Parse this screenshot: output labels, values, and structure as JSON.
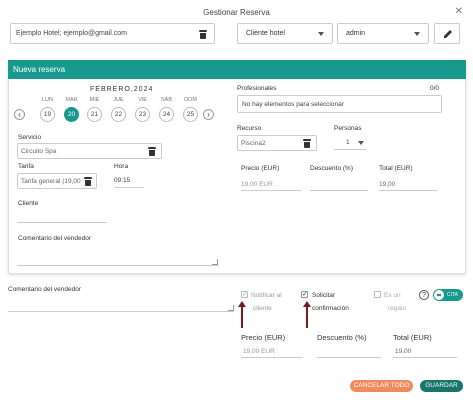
{
  "dialog": {
    "title": "Gestionar Reserva"
  },
  "customer_field": {
    "value": "Ejemplo Hotel; ejemplo@gmail.com"
  },
  "client_type_select": {
    "value": "Cliente hotel"
  },
  "user_select": {
    "value": "admin"
  },
  "panel": {
    "title": "Nueva reserva"
  },
  "calendar": {
    "month": "FEBRERO,2024",
    "dows": [
      "LUN",
      "MAR",
      "MIÉ",
      "JUE",
      "VIE",
      "SÁB",
      "DOM"
    ],
    "days": [
      "19",
      "20",
      "21",
      "22",
      "23",
      "24",
      "25"
    ],
    "selected_day": "20"
  },
  "form": {
    "servicio_label": "Servicio",
    "servicio_value": "Circuito Spa",
    "tarifa_label": "Tarifa",
    "tarifa_value": "Tarifa general (19,00",
    "hora_label": "Hora",
    "hora_value": "09:15",
    "cliente_label": "Cliente",
    "comentario_label": "Comentario del vendedor",
    "profesionales_label": "Profesionales",
    "profesionales_count": "0/0",
    "profesionales_placeholder": "No hay elementos para seleccionar",
    "recurso_label": "Recurso",
    "recurso_value": "Piscina2",
    "personas_label": "Personas",
    "personas_value": "1",
    "precio_label": "Precio (EUR)",
    "precio_value": "19,00 EUR",
    "descuento_label": "Descuento (%)",
    "total_label": "Total (EUR)",
    "total_value": "19,00"
  },
  "bottom": {
    "comentario_label": "Comentario del vendedor",
    "notificar_line1": "Notificar al",
    "notificar_line2": "cliente",
    "solicitar_line1": "Solicitar",
    "solicitar_line2": "confirmación",
    "regalo_line1": "Es un",
    "regalo_line2": "regalo",
    "toggle_text": "CITA",
    "precio_label": "Precio (EUR)",
    "precio_value": "19,00 EUR",
    "descuento_label": "Descuento (%)",
    "total_label": "Total (EUR)",
    "total_value": "19,00"
  },
  "actions": {
    "cancel_label": "CANCELAR TODO",
    "save_label": "GUARDAR"
  },
  "colors": {
    "accent": "#17998d",
    "cancel": "#f08a5d",
    "save": "#17756b",
    "annotation": "#7a1b1b"
  }
}
